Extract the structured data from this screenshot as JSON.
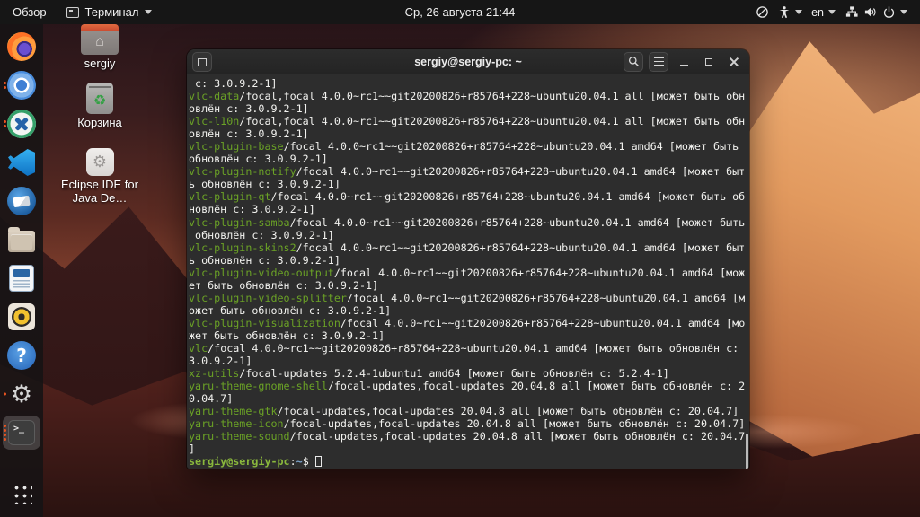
{
  "top_bar": {
    "activities_label": "Обзор",
    "app_menu_label": "Терминал",
    "clock": "Ср, 26 августа  21:44",
    "keyboard_layout": "en"
  },
  "desktop": {
    "icons": [
      {
        "id": "home-folder",
        "label": "sergiy"
      },
      {
        "id": "trash",
        "label": "Корзина"
      },
      {
        "id": "eclipse",
        "label": "Eclipse IDE for Java De…"
      }
    ]
  },
  "dock": {
    "items": [
      {
        "id": "firefox",
        "dots": 0,
        "active": false
      },
      {
        "id": "chromium",
        "dots": 2,
        "active": false
      },
      {
        "id": "app-x",
        "dots": 2,
        "active": false
      },
      {
        "id": "vscode",
        "dots": 0,
        "active": false
      },
      {
        "id": "thunderbird",
        "dots": 0,
        "active": false
      },
      {
        "id": "files",
        "dots": 0,
        "active": false
      },
      {
        "id": "writer",
        "dots": 0,
        "active": false
      },
      {
        "id": "rhythmbox",
        "dots": 0,
        "active": false
      },
      {
        "id": "help",
        "dots": 0,
        "active": false
      },
      {
        "id": "settings",
        "dots": 1,
        "active": false
      },
      {
        "id": "terminal",
        "dots": 4,
        "active": true
      }
    ],
    "indicator_color": "#e95420"
  },
  "terminal": {
    "title": "sergiy@sergiy-pc: ~",
    "colors": {
      "background": "#2d2d2d",
      "foreground": "#f2f2ef",
      "package_green": "#6ba226"
    },
    "lines": [
      [
        [
          "fg",
          " c: 3.0.9.2-1]"
        ]
      ],
      [
        [
          "pkg",
          "vlc-data"
        ],
        [
          "fg",
          "/focal,focal 4.0.0~rc1~~git20200826+r85764+228~ubuntu20.04.1 all [может быть обн"
        ]
      ],
      [
        [
          "fg",
          "овлён с: 3.0.9.2-1]"
        ]
      ],
      [
        [
          "pkg",
          "vlc-l10n"
        ],
        [
          "fg",
          "/focal,focal 4.0.0~rc1~~git20200826+r85764+228~ubuntu20.04.1 all [может быть обн"
        ]
      ],
      [
        [
          "fg",
          "овлён с: 3.0.9.2-1]"
        ]
      ],
      [
        [
          "pkg",
          "vlc-plugin-base"
        ],
        [
          "fg",
          "/focal 4.0.0~rc1~~git20200826+r85764+228~ubuntu20.04.1 amd64 [может быть"
        ]
      ],
      [
        [
          "fg",
          "обновлён с: 3.0.9.2-1]"
        ]
      ],
      [
        [
          "pkg",
          "vlc-plugin-notify"
        ],
        [
          "fg",
          "/focal 4.0.0~rc1~~git20200826+r85764+228~ubuntu20.04.1 amd64 [может быт"
        ]
      ],
      [
        [
          "fg",
          "ь обновлён с: 3.0.9.2-1]"
        ]
      ],
      [
        [
          "pkg",
          "vlc-plugin-qt"
        ],
        [
          "fg",
          "/focal 4.0.0~rc1~~git20200826+r85764+228~ubuntu20.04.1 amd64 [может быть об"
        ]
      ],
      [
        [
          "fg",
          "новлён с: 3.0.9.2-1]"
        ]
      ],
      [
        [
          "pkg",
          "vlc-plugin-samba"
        ],
        [
          "fg",
          "/focal 4.0.0~rc1~~git20200826+r85764+228~ubuntu20.04.1 amd64 [может быть"
        ]
      ],
      [
        [
          "fg",
          " обновлён с: 3.0.9.2-1]"
        ]
      ],
      [
        [
          "pkg",
          "vlc-plugin-skins2"
        ],
        [
          "fg",
          "/focal 4.0.0~rc1~~git20200826+r85764+228~ubuntu20.04.1 amd64 [может быт"
        ]
      ],
      [
        [
          "fg",
          "ь обновлён с: 3.0.9.2-1]"
        ]
      ],
      [
        [
          "pkg",
          "vlc-plugin-video-output"
        ],
        [
          "fg",
          "/focal 4.0.0~rc1~~git20200826+r85764+228~ubuntu20.04.1 amd64 [мож"
        ]
      ],
      [
        [
          "fg",
          "ет быть обновлён с: 3.0.9.2-1]"
        ]
      ],
      [
        [
          "pkg",
          "vlc-plugin-video-splitter"
        ],
        [
          "fg",
          "/focal 4.0.0~rc1~~git20200826+r85764+228~ubuntu20.04.1 amd64 [м"
        ]
      ],
      [
        [
          "fg",
          "ожет быть обновлён с: 3.0.9.2-1]"
        ]
      ],
      [
        [
          "pkg",
          "vlc-plugin-visualization"
        ],
        [
          "fg",
          "/focal 4.0.0~rc1~~git20200826+r85764+228~ubuntu20.04.1 amd64 [мо"
        ]
      ],
      [
        [
          "fg",
          "жет быть обновлён с: 3.0.9.2-1]"
        ]
      ],
      [
        [
          "pkg",
          "vlc"
        ],
        [
          "fg",
          "/focal 4.0.0~rc1~~git20200826+r85764+228~ubuntu20.04.1 amd64 [может быть обновлён с:"
        ]
      ],
      [
        [
          "fg",
          "3.0.9.2-1]"
        ]
      ],
      [
        [
          "pkg",
          "xz-utils"
        ],
        [
          "fg",
          "/focal-updates 5.2.4-1ubuntu1 amd64 [может быть обновлён с: 5.2.4-1]"
        ]
      ],
      [
        [
          "pkg",
          "yaru-theme-gnome-shell"
        ],
        [
          "fg",
          "/focal-updates,focal-updates 20.04.8 all [может быть обновлён с: 2"
        ]
      ],
      [
        [
          "fg",
          "0.04.7]"
        ]
      ],
      [
        [
          "pkg",
          "yaru-theme-gtk"
        ],
        [
          "fg",
          "/focal-updates,focal-updates 20.04.8 all [может быть обновлён с: 20.04.7]"
        ]
      ],
      [
        [
          "pkg",
          "yaru-theme-icon"
        ],
        [
          "fg",
          "/focal-updates,focal-updates 20.04.8 all [может быть обновлён с: 20.04.7]"
        ]
      ],
      [
        [
          "pkg",
          "yaru-theme-sound"
        ],
        [
          "fg",
          "/focal-updates,focal-updates 20.04.8 all [может быть обновлён с: 20.04.7"
        ]
      ],
      [
        [
          "fg",
          "]"
        ]
      ]
    ],
    "prompt": {
      "user_host": "sergiy@sergiy-pc",
      "colon": ":",
      "path": "~",
      "dollar": "$ "
    }
  }
}
